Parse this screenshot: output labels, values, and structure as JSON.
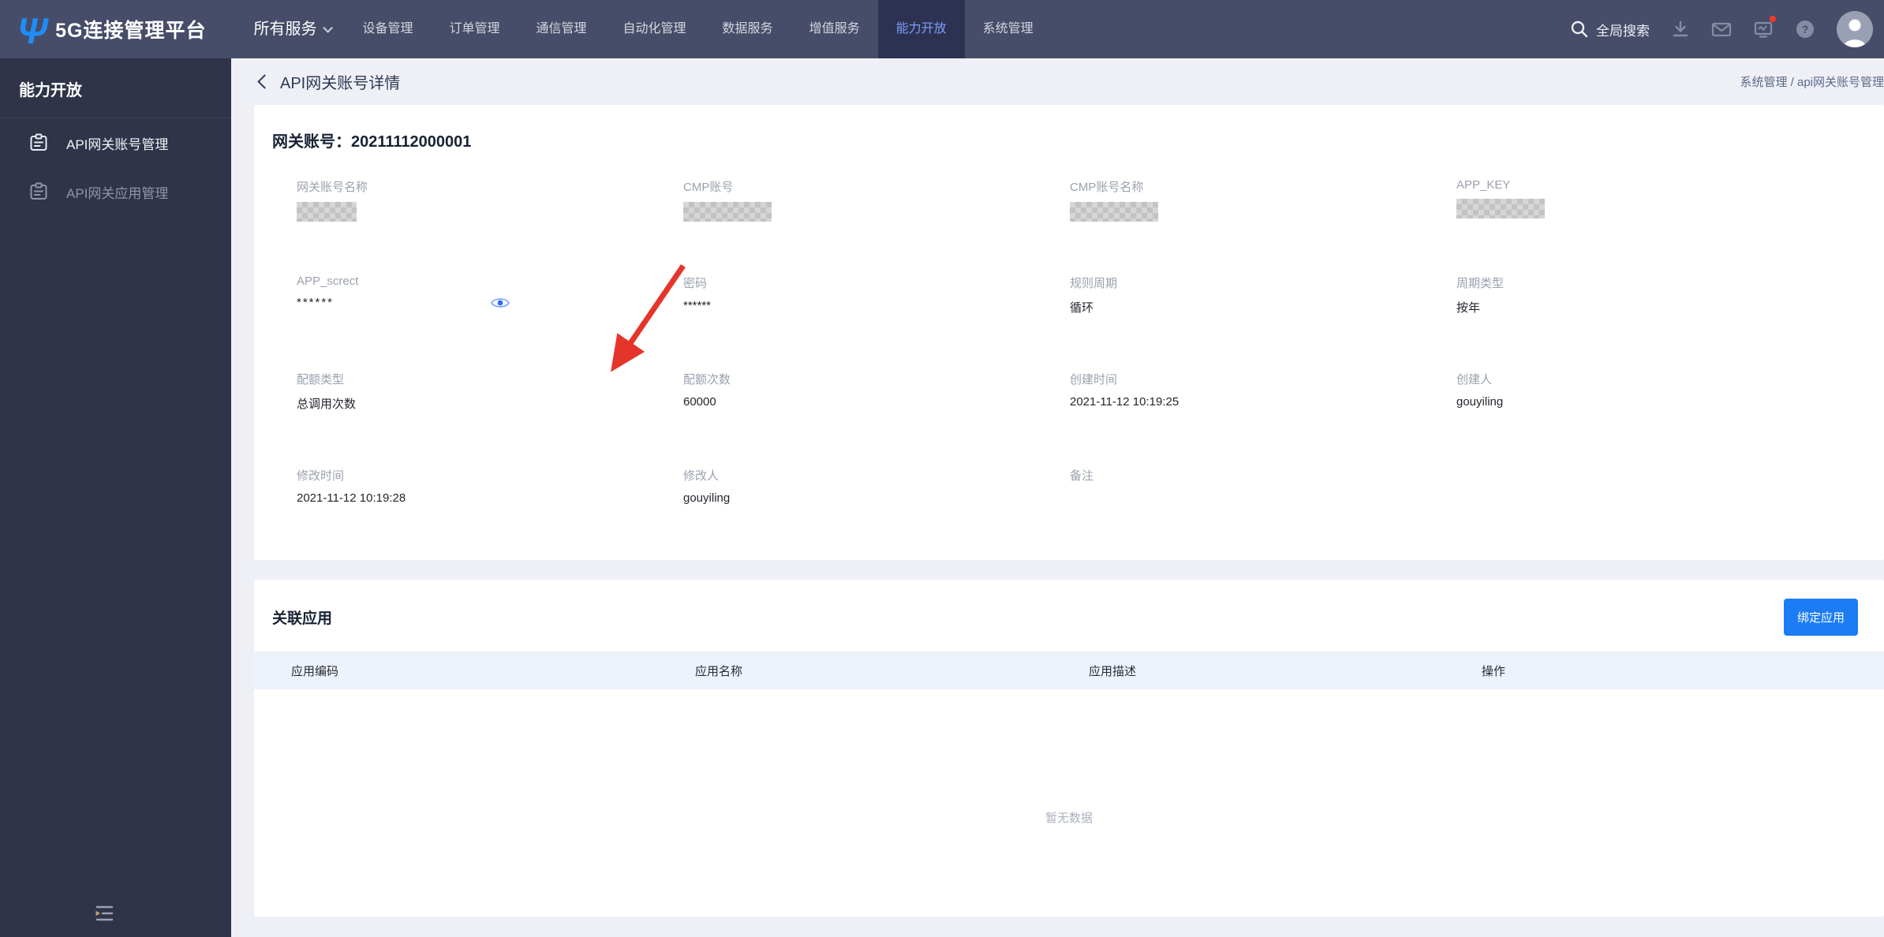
{
  "navbar": {
    "logo_glyph": "Ψ",
    "logo_text": "5G连接管理平台",
    "menu": [
      {
        "label": "所有服务",
        "dropdown": true,
        "active": false
      },
      {
        "label": "设备管理",
        "active": false
      },
      {
        "label": "订单管理",
        "active": false
      },
      {
        "label": "通信管理",
        "active": false
      },
      {
        "label": "自动化管理",
        "active": false
      },
      {
        "label": "数据服务",
        "active": false
      },
      {
        "label": "增值服务",
        "active": false
      },
      {
        "label": "能力开放",
        "active": true
      },
      {
        "label": "系统管理",
        "active": false
      }
    ],
    "search_label": "全局搜索",
    "icons": {
      "search": "magnifier",
      "download": "arrow-down-to-line",
      "mail": "envelope",
      "monitor": "screen-with-pulse-and-red-badge",
      "help": "question-mark-circle",
      "avatar": "person-circle"
    }
  },
  "sidebar": {
    "title": "能力开放",
    "items": [
      {
        "label": "API网关账号管理",
        "active": true,
        "icon": "clipboard"
      },
      {
        "label": "API网关应用管理",
        "active": false,
        "icon": "clipboard"
      }
    ],
    "collapse_icon": "menu-fold"
  },
  "page_header": {
    "title": "API网关账号详情",
    "back_icon": "chevron-left",
    "breadcrumb": "系统管理 / api网关账号管理"
  },
  "detail_card": {
    "title": "网关账号：20211112000001",
    "fields": [
      {
        "label": "网关账号名称",
        "masked": true
      },
      {
        "label": "CMP账号",
        "masked": true
      },
      {
        "label": "CMP账号名称",
        "masked": true
      },
      {
        "label": "APP_KEY",
        "masked": true
      },
      {
        "label": "APP_screct",
        "value": "******",
        "eye_icon": true
      },
      {
        "label": "密码",
        "value": "******"
      },
      {
        "label": "规则周期",
        "value": "循环"
      },
      {
        "label": "周期类型",
        "value": "按年"
      },
      {
        "label": "配额类型",
        "value": "总调用次数"
      },
      {
        "label": "配额次数",
        "value": "60000"
      },
      {
        "label": "创建时间",
        "value": "2021-11-12 10:19:25"
      },
      {
        "label": "创建人",
        "value": "gouyiling"
      },
      {
        "label": "修改时间",
        "value": "2021-11-12 10:19:28"
      },
      {
        "label": "修改人",
        "value": "gouyiling"
      },
      {
        "label": "备注",
        "value": ""
      }
    ],
    "annotation": "red-arrow-pointing-at-APP_screct"
  },
  "related_card": {
    "title": "关联应用",
    "bind_button_label": "绑定应用",
    "table_headers": [
      "应用编码",
      "应用名称",
      "应用描述",
      "操作"
    ],
    "empty_text": "暂无数据"
  },
  "colors": {
    "navbar_bg": "#474d68",
    "navbar_active_bg": "#2d3252",
    "navbar_active_text": "#7d9cf7",
    "sidebar_bg": "#2f3449",
    "main_bg": "#eef0f6",
    "accent_blue": "#1b7cf4",
    "arrow_red": "#e5352b",
    "eye_blue": "#4c86ff",
    "table_header_bg": "#eef2fa"
  }
}
